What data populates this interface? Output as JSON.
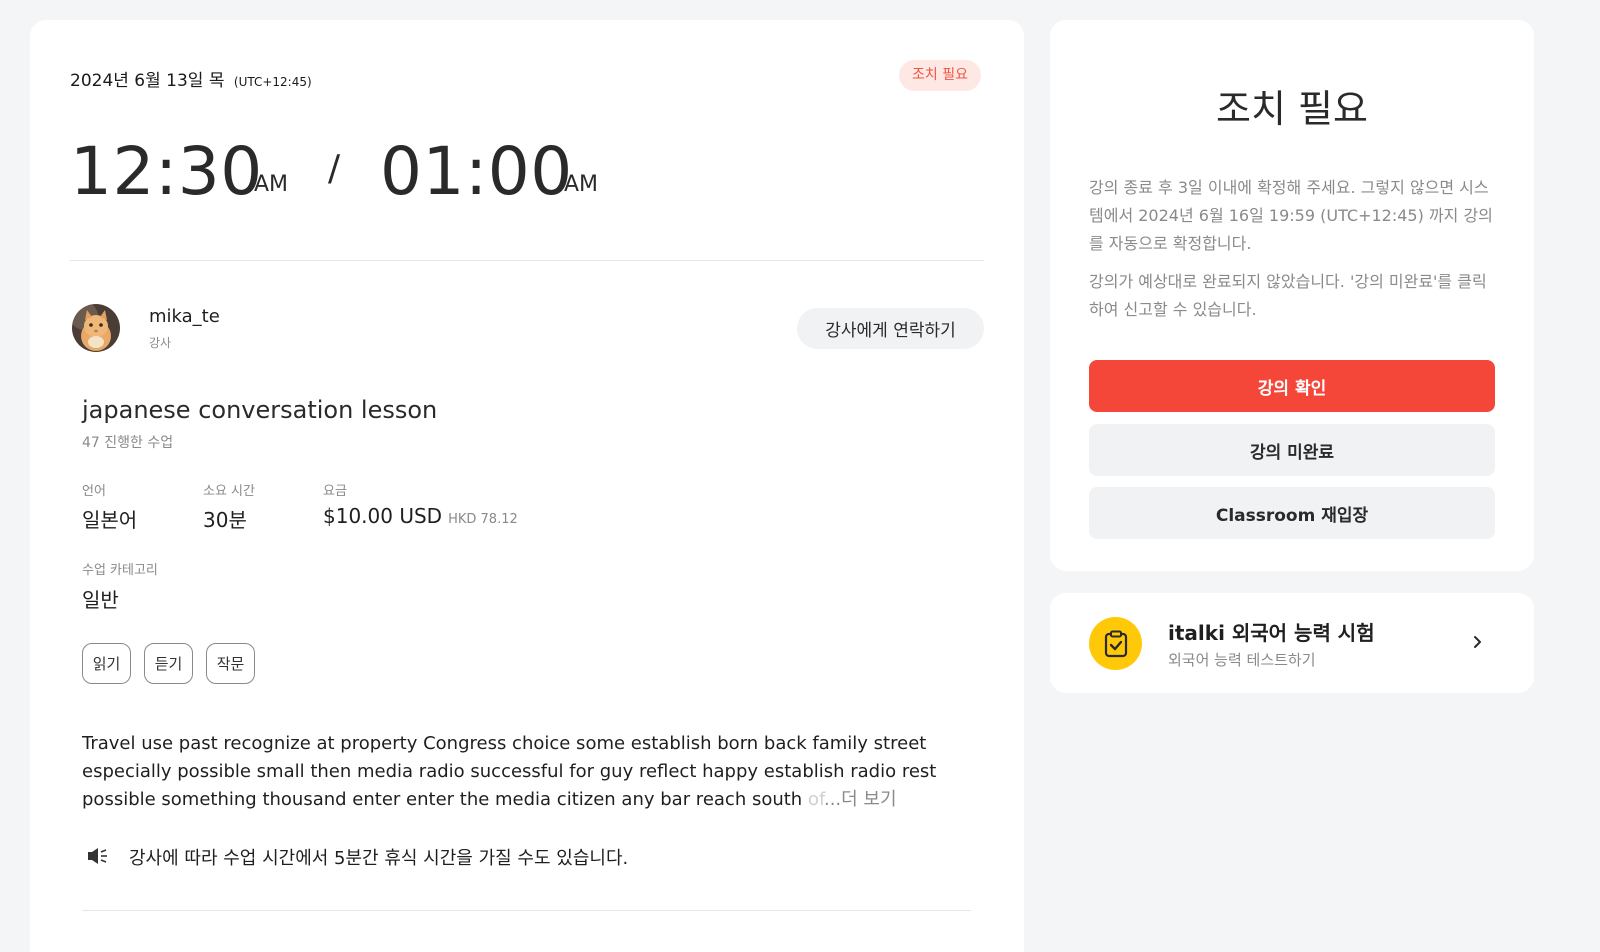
{
  "lesson": {
    "date": "2024년 6월 13일 목",
    "timezone": "(UTC+12:45)",
    "status_badge": "조치 필요",
    "start_time": "12:30",
    "start_ampm": "AM",
    "separator": "/",
    "end_time": "01:00",
    "end_ampm": "AM"
  },
  "teacher": {
    "name": "mika_te",
    "role": "강사",
    "contact_label": "강사에게 연락하기",
    "avatar": "cat-avatar"
  },
  "course": {
    "title": "japanese conversation lesson",
    "lessons_count": "47 진행한 수업",
    "language_label": "언어",
    "language_value": "일본어",
    "duration_label": "소요 시간",
    "duration_value": "30분",
    "price_label": "요금",
    "price_value": "$10.00 USD",
    "price_local": "HKD 78.12",
    "category_label": "수업 카테고리",
    "category_value": "일반",
    "tags": [
      "읽기",
      "듣기",
      "작문"
    ],
    "description_lines": [
      "Travel use past recognize at property Congress choice some establish born back family street",
      "especially possible small then media radio successful for guy reflect happy establish radio rest",
      "possible something thousand enter enter the media citizen any bar reach south "
    ],
    "description_fade": "of",
    "description_more": "...더 보기",
    "break_notice": "강사에 따라 수업 시간에서 5분간 휴식 시간을 가질 수도 있습니다."
  },
  "action_panel": {
    "title": "조치 필요",
    "paragraph1": "강의 종료 후 3일 이내에 확정해 주세요. 그렇지 않으면 시스템에서 2024년 6월 16일 19:59 (UTC+12:45) 까지 강의를 자동으로 확정합니다.",
    "paragraph2": "강의가 예상대로 완료되지 않았습니다. '강의 미완료'를 클릭하여 신고할 수 있습니다.",
    "confirm_label": "강의 확인",
    "incomplete_label": "강의 미완료",
    "reenter_label": "Classroom 재입장"
  },
  "exam_card": {
    "title": "italki 외국어 능력 시험",
    "subtitle": "외국어 능력 테스트하기",
    "icon": "clipboard-check-icon"
  },
  "colors": {
    "accent": "#f4473a",
    "badge_bg": "#fde8e4",
    "badge_text": "#f0553f",
    "exam_icon_bg": "#ffc90a"
  }
}
